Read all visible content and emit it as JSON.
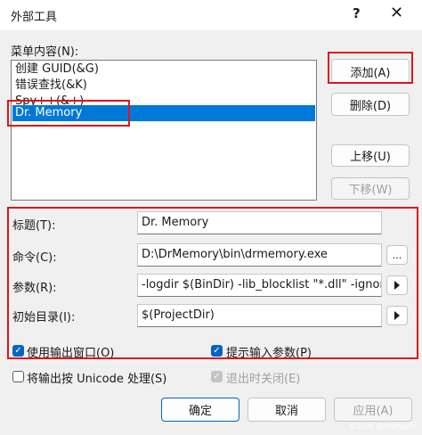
{
  "window": {
    "title": "外部工具",
    "help": "?",
    "close": "✕"
  },
  "menu_label": "菜单内容(N):",
  "list_items": [
    "创建 GUID(&G)",
    "错误查找(&K)",
    "Spy++(&+)",
    "Dr. Memory"
  ],
  "buttons": {
    "add": "添加(A)",
    "delete": "删除(D)",
    "move_up": "上移(U)",
    "move_down": "下移(W)",
    "ok": "确定",
    "cancel": "取消",
    "apply": "应用(A)",
    "browse": "..."
  },
  "fields": {
    "title_label": "标题(T):",
    "title_value": "Dr. Memory",
    "command_label": "命令(C):",
    "command_value": "D:\\DrMemory\\bin\\drmemory.exe",
    "args_label": "参数(R):",
    "args_value": " -logdir $(BinDir) -lib_blocklist \"*.dll\" -ignore_",
    "dir_label": "初始目录(I):",
    "dir_value": "$(ProjectDir)"
  },
  "checkboxes": {
    "use_output_window": "使用输出窗口(O)",
    "prompt_args": "提示输入参数(P)",
    "unicode_output": "将输出按 Unicode 处理(S)",
    "close_on_exit": "退出时关闭(E)"
  },
  "watermark": "CSDN @mahoife",
  "colors": {
    "accent": "#0067c0",
    "selection": "#0078d7",
    "highlight_box": "#e0141e"
  }
}
